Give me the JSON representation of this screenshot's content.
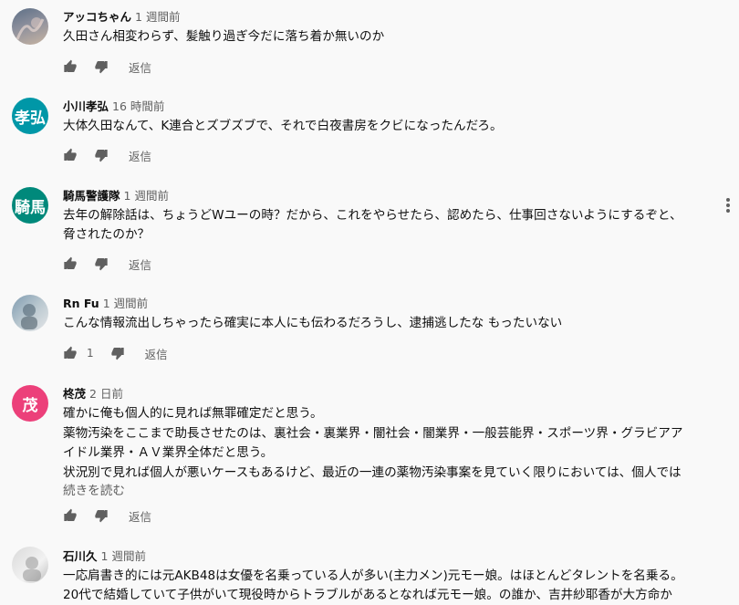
{
  "comments": [
    {
      "author": "アッコちゃん",
      "time": "1 週間前",
      "lines": [
        "久田さん相変わらず、髪触り過ぎ今だに落ち着か無いのか"
      ],
      "likes": "",
      "reply": "返信",
      "avatar": {
        "type": "photo",
        "colors": [
          "#6b7a8f",
          "#c9b7a6"
        ]
      }
    },
    {
      "author": "小川孝弘",
      "time": "16 時間前",
      "lines": [
        "大体久田なんて、K連合とズブズブで、それで白夜書房をクビになったんだろ。"
      ],
      "likes": "",
      "reply": "返信",
      "avatar": {
        "type": "initials",
        "text": "孝弘",
        "color": "#0097a7"
      }
    },
    {
      "author": "騎馬警護隊",
      "time": "1 週間前",
      "lines": [
        "去年の解除話は、ちょうどWユーの時？だから、これをやらせたら、認めたら、仕事回さないようにするぞと、",
        "脅されたのか？"
      ],
      "likes": "",
      "reply": "返信",
      "avatar": {
        "type": "initials",
        "text": "騎馬",
        "color": "#00897b"
      }
    },
    {
      "author": "Rn Fu",
      "time": "1 週間前",
      "lines": [
        "こんな情報流出しちゃったら確実に本人にも伝わるだろうし、逮捕逃したな もったいない"
      ],
      "likes": "1",
      "reply": "返信",
      "avatar": {
        "type": "photo",
        "colors": [
          "#7f9bb0",
          "#d5d9dc"
        ]
      }
    },
    {
      "author": "柊茂",
      "time": "2 日前",
      "lines": [
        "確かに俺も個人的に見れば無罪確定だと思う。",
        "薬物汚染をここまで助長させたのは、裏社会・裏業界・闇社会・闇業界・一般芸能界・スポーツ界・グラビアア",
        "イドル業界・ＡＶ業界全体だと思う。",
        "状況別で見れば個人が悪いケースもあるけど、最近の一連の薬物汚染事案を見ていく限りにおいては、個人では"
      ],
      "more": "続きを読む",
      "likes": "",
      "reply": "返信",
      "avatar": {
        "type": "initials",
        "text": "茂",
        "color": "#ec407a"
      }
    },
    {
      "author": "石川久",
      "time": "1 週間前",
      "lines": [
        "一応肩書き的には元AKB48は女優を名乗っている人が多い(主力メン)元モー娘。はほとんどタレントを名乗る。",
        "20代で結婚していて子供がいて現役時からトラブルがあるとなれば元モー娘。の誰か、吉井紗耶香が大方命か"
      ],
      "likes": "",
      "reply": "返信",
      "avatar": {
        "type": "photo",
        "colors": [
          "#cfcfcf",
          "#ffffff"
        ]
      }
    }
  ],
  "icons": {
    "like": "thumb-up-icon",
    "dislike": "thumb-down-icon",
    "menu": "more-vert-icon"
  }
}
